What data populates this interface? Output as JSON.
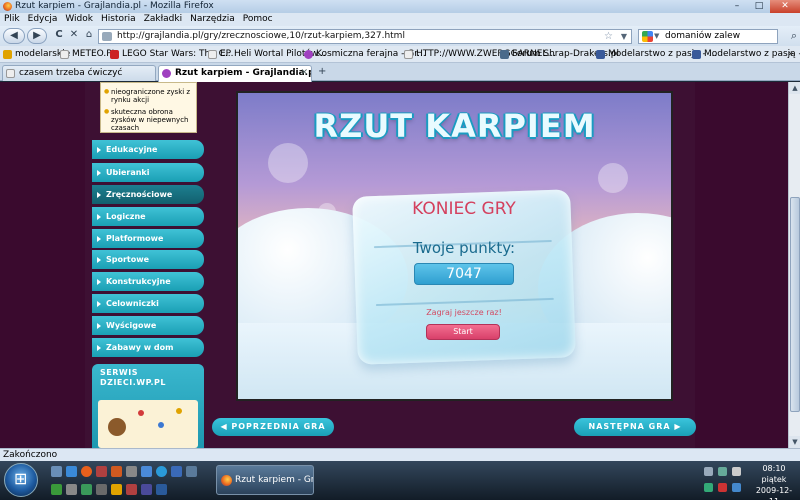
{
  "window": {
    "title": "Rzut karpiem - Grajlandia.pl - Mozilla Firefox",
    "minimize": "–",
    "maximize": "□",
    "close": "✕"
  },
  "menu": [
    "Plik",
    "Edycja",
    "Widok",
    "Historia",
    "Zakładki",
    "Narzędzia",
    "Pomoc"
  ],
  "nav": {
    "back_icon": "back-arrow-icon",
    "forward_icon": "forward-arrow-icon",
    "reload_icon": "reload-icon",
    "stop_icon": "stop-icon",
    "home_icon": "home-icon",
    "back": "◀",
    "forward": "▶",
    "reload": "C",
    "stop": "✕",
    "home": "⌂",
    "url": "http://grajlandia.pl/gry/zrecznosciowe,10/rzut-karpiem,327.html",
    "star": "☆",
    "dropdown": "▼",
    "search_value": "domaniów zalew",
    "search_icon": "⌕"
  },
  "bookmarks": [
    "modelarskie",
    "METEO.PL",
    "LEGO Star Wars: The C...",
    "EP Heli Wortal Pilotów...",
    "Kosmiczna ferajna - Gr...",
    "HTTP://WWW.ZWERGGARNEL...",
    "Forum Shrap-Drakers.pl",
    "Modelarstwo z pasją - ...",
    "Modelarstwo z pasją - ..."
  ],
  "bookmark_more": "»",
  "tabs": [
    {
      "label": "czasem trzeba ćwiczyć",
      "active": false
    },
    {
      "label": "Rzut karpiem - Grajlandia.pl",
      "active": true
    }
  ],
  "tab_close": "✕",
  "new_tab": "+",
  "promo": {
    "line1": "nieograniczone zyski z rynku akcji",
    "line2": "skuteczna obrona zysków w niepewnych czasach"
  },
  "sidebar": [
    {
      "label": "Edukacyjne",
      "selected": false
    },
    {
      "label": "Ubieranki",
      "selected": false
    },
    {
      "label": "Zręcznościowe",
      "selected": true
    },
    {
      "label": "Logiczne",
      "selected": false
    },
    {
      "label": "Platformowe",
      "selected": false
    },
    {
      "label": "Sportowe",
      "selected": false
    },
    {
      "label": "Konstrukcyjne",
      "selected": false
    },
    {
      "label": "Celowniczki",
      "selected": false
    },
    {
      "label": "Wyścigowe",
      "selected": false
    },
    {
      "label": "Zabawy w dom",
      "selected": false
    }
  ],
  "serwis": {
    "line1": "SERWIS",
    "line2": "DZIECI.WP.PL"
  },
  "game": {
    "title": "RZUT KARPIEM",
    "game_over": "KONIEC GRY",
    "points_label": "Twoje punkty:",
    "points_value": "7047",
    "play_again": "Zagraj jeszcze raz!",
    "start_label": "Start"
  },
  "pager": {
    "prev": "◀ POPRZEDNIA GRA",
    "next": "NASTĘPNA GRA ▶"
  },
  "status": "Zakończono",
  "taskbar": {
    "window_label": "Rzut karpiem - Grajl...",
    "time": "08:10",
    "day": "piątek",
    "date": "2009-12-11"
  },
  "colors": {
    "sidebar_item": "#1a9fb4",
    "sidebar_selected": "#12606e",
    "game_title": "#e9fbff",
    "game_over_text": "#d4405e",
    "points_box": "#2f9fd0",
    "start_button": "#d8406a"
  }
}
